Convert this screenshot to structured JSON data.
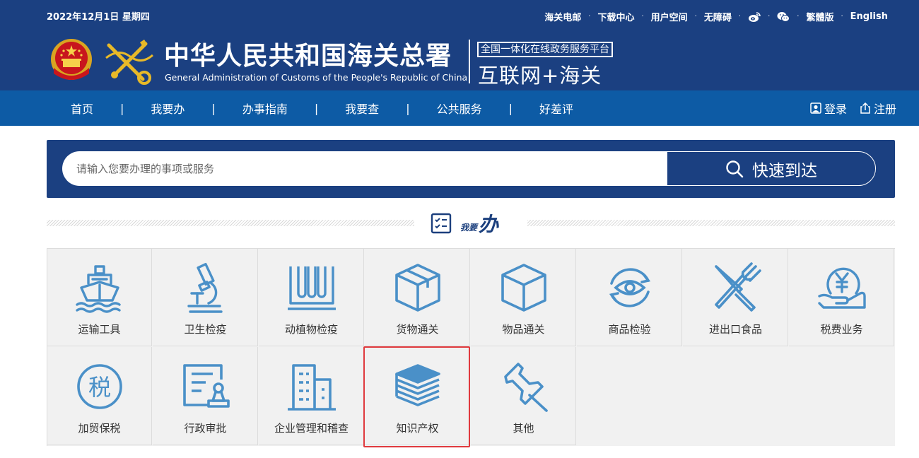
{
  "header": {
    "date": "2022年12月1日  星期四",
    "top_links": [
      "海关电邮",
      "下载中心",
      "用户空间",
      "无障碍",
      "繁體版",
      "English"
    ],
    "title_cn": "中华人民共和国海关总署",
    "title_en": "General Administration of Customs of the People's Republic of China",
    "platform_badge": "全国一体化在线政务服务平台",
    "platform_name": "互联网+海关"
  },
  "nav": {
    "items": [
      "首页",
      "我要办",
      "办事指南",
      "我要查",
      "公共服务",
      "好差评"
    ],
    "login": "登录",
    "register": "注册"
  },
  "search": {
    "placeholder": "请输入您要办理的事项或服务",
    "button_label": "快速到达"
  },
  "section": {
    "title_small": "我要",
    "title_big": "办"
  },
  "services": [
    {
      "label": "运输工具",
      "icon": "ship-icon"
    },
    {
      "label": "卫生检疫",
      "icon": "microscope-icon"
    },
    {
      "label": "动植物检疫",
      "icon": "test-tubes-icon"
    },
    {
      "label": "货物通关",
      "icon": "package-icon"
    },
    {
      "label": "物品通关",
      "icon": "box-icon"
    },
    {
      "label": "商品检验",
      "icon": "eye-refresh-icon"
    },
    {
      "label": "进出口食品",
      "icon": "fork-knife-icon"
    },
    {
      "label": "税费业务",
      "icon": "yen-hand-icon"
    },
    {
      "label": "加贸保税",
      "icon": "tax-seal-icon"
    },
    {
      "label": "行政审批",
      "icon": "approval-form-icon"
    },
    {
      "label": "企业管理和稽查",
      "icon": "building-icon"
    },
    {
      "label": "知识产权",
      "icon": "books-icon"
    },
    {
      "label": "其他",
      "icon": "pushpin-icon"
    }
  ],
  "colors": {
    "header_bg": "#1b4081",
    "nav_bg": "#0d5ba5",
    "icon": "#4a90c8",
    "highlight": "#e03a3e"
  }
}
